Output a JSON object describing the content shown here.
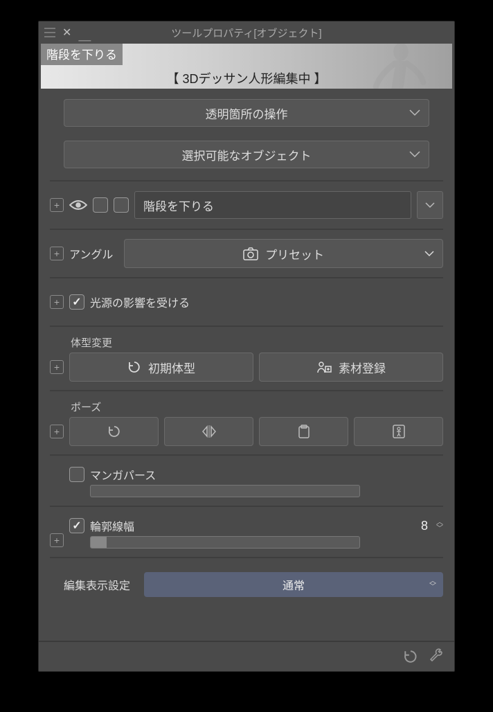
{
  "titlebar": {
    "title": "ツールプロパティ[オブジェクト]"
  },
  "thumbnail": {
    "tag": "階段を下りる",
    "caption": "【 3Dデッサン人形編集中 】"
  },
  "dropdowns": {
    "transparent_op": "透明箇所の操作",
    "selectable_obj": "選択可能なオブジェクト"
  },
  "object_row": {
    "name": "階段を下りる"
  },
  "angle": {
    "label": "アングル",
    "preset_btn": "プリセット"
  },
  "light": {
    "label": "光源の影響を受ける",
    "checked": true
  },
  "body_type": {
    "section": "体型変更",
    "initial_btn": "初期体型",
    "register_btn": "素材登録"
  },
  "pose": {
    "section": "ポーズ"
  },
  "manga_perspective": {
    "label": "マンガパース",
    "checked": false,
    "slider_pct": 0
  },
  "outline": {
    "label": "輪郭線幅",
    "checked": true,
    "value": "8",
    "slider_pct": 6
  },
  "edit_display": {
    "label": "編集表示設定",
    "value": "通常"
  }
}
